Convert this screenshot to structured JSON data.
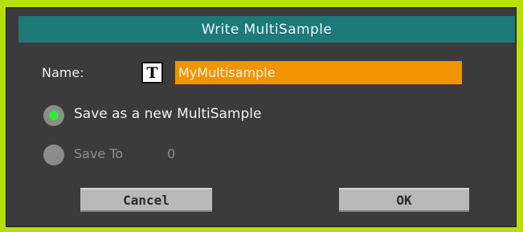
{
  "dialog": {
    "title": "Write MultiSample",
    "name_label": "Name:",
    "text_icon_glyph": "T",
    "name_value": "MyMultisample",
    "options": [
      {
        "label": "Save as a new MultiSample",
        "selected": true,
        "enabled": true
      },
      {
        "label": "Save To",
        "value": "0",
        "selected": false,
        "enabled": false
      }
    ],
    "buttons": {
      "cancel": "Cancel",
      "ok": "OK"
    }
  },
  "colors": {
    "frame": "#b7e00a",
    "title_bar": "#1c7a78",
    "name_field": "#f09400",
    "radio_selected": "#35e835"
  }
}
